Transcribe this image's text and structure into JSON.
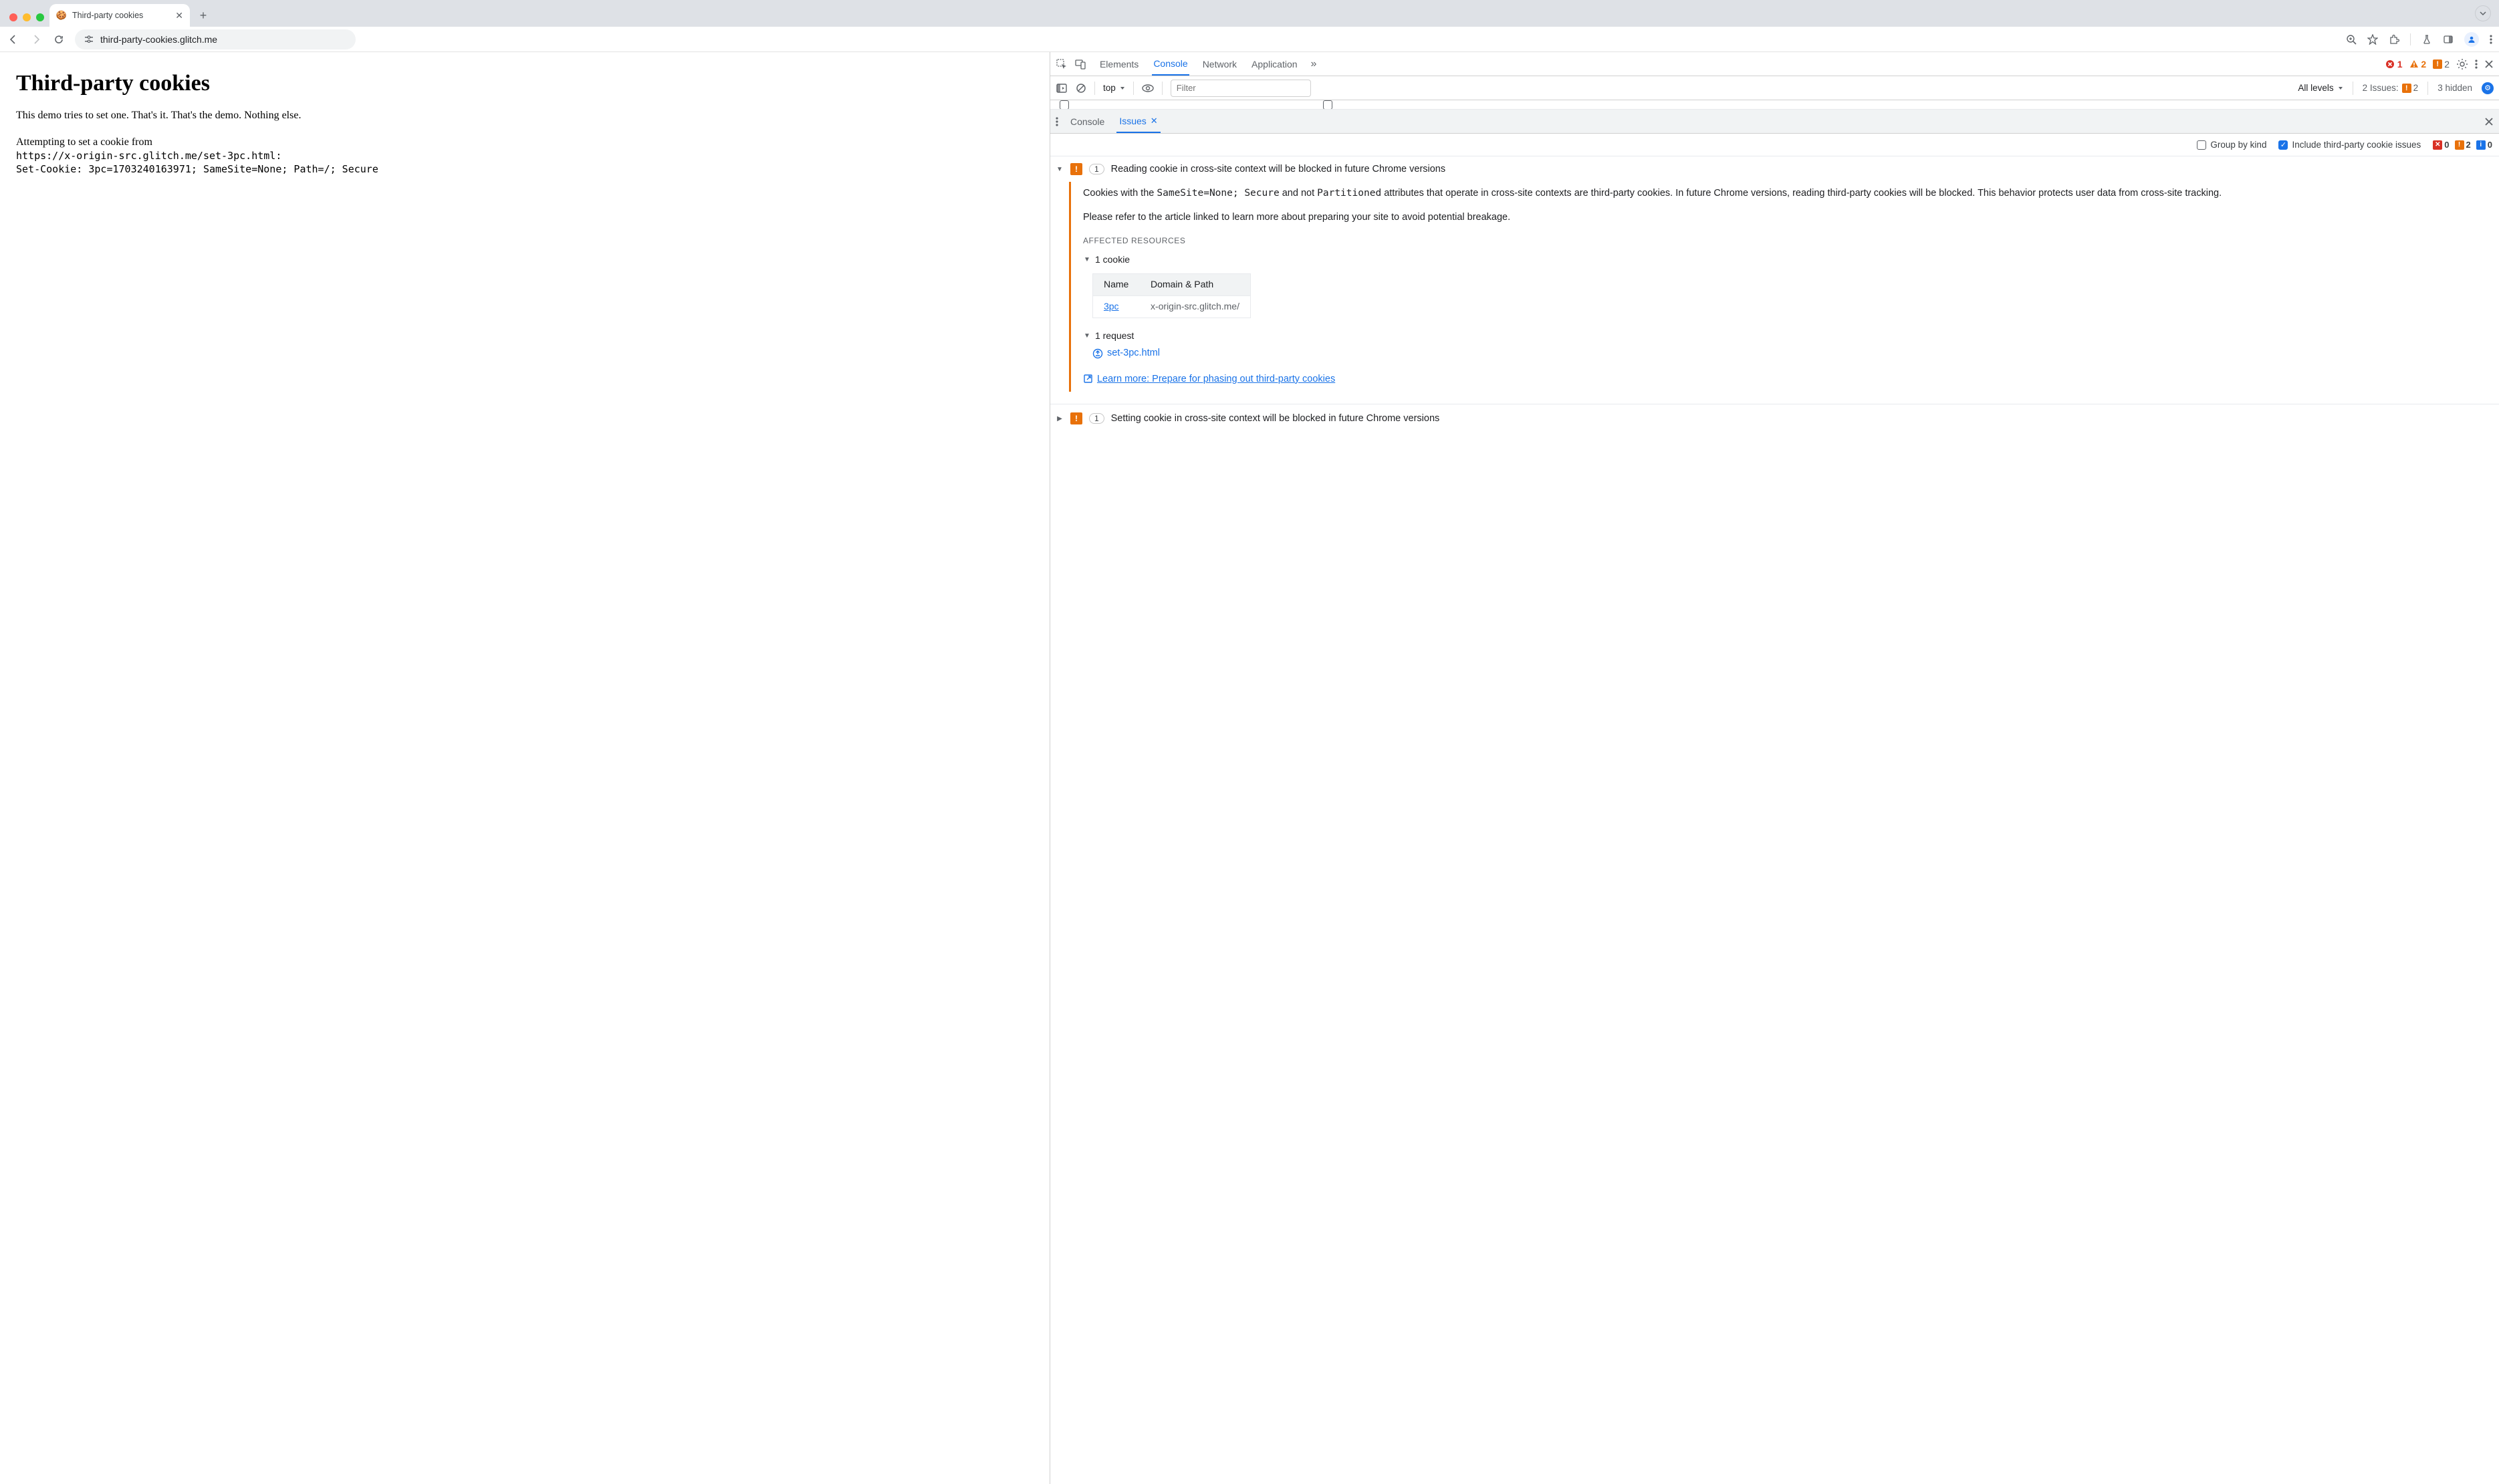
{
  "browser": {
    "tab_title": "Third-party cookies",
    "url": "third-party-cookies.glitch.me"
  },
  "page": {
    "h1": "Third-party cookies",
    "intro": "This demo tries to set one. That's it. That's the demo. Nothing else.",
    "attempt_line": "Attempting to set a cookie from",
    "code_line1": "https://x-origin-src.glitch.me/set-3pc.html:",
    "code_line2": "Set-Cookie: 3pc=1703240163971; SameSite=None; Path=/; Secure"
  },
  "devtools": {
    "tabs": [
      "Elements",
      "Console",
      "Network",
      "Application"
    ],
    "active_tab": "Console",
    "errors_count": "1",
    "warnings_count": "2",
    "issues_count": "2",
    "toolbar": {
      "context": "top",
      "filter_placeholder": "Filter",
      "levels": "All levels",
      "issues_label": "2 Issues:",
      "issues_badge": "2",
      "hidden": "3 hidden"
    },
    "drawer": {
      "tabs": [
        "Console",
        "Issues"
      ],
      "active": "Issues",
      "group_label": "Group by kind",
      "include_label": "Include third-party cookie issues",
      "counts": {
        "err": "0",
        "warn": "2",
        "info": "0"
      }
    },
    "issue1": {
      "count": "1",
      "title": "Reading cookie in cross-site context will be blocked in future Chrome versions",
      "para1_a": "Cookies with the ",
      "para1_code1": "SameSite=None; Secure",
      "para1_b": " and not ",
      "para1_code2": "Partitioned",
      "para1_c": " attributes that operate in cross-site contexts are third-party cookies. In future Chrome versions, reading third-party cookies will be blocked. This behavior protects user data from cross-site tracking.",
      "para2": "Please refer to the article linked to learn more about preparing your site to avoid potential breakage.",
      "aff": "AFFECTED RESOURCES",
      "cookie_count": "1 cookie",
      "table": {
        "h1": "Name",
        "h2": "Domain & Path",
        "name": "3pc",
        "domain": "x-origin-src.glitch.me/"
      },
      "req_count": "1 request",
      "req_name": "set-3pc.html",
      "learn": "Learn more: Prepare for phasing out third-party cookies"
    },
    "issue2": {
      "count": "1",
      "title": "Setting cookie in cross-site context will be blocked in future Chrome versions"
    }
  }
}
